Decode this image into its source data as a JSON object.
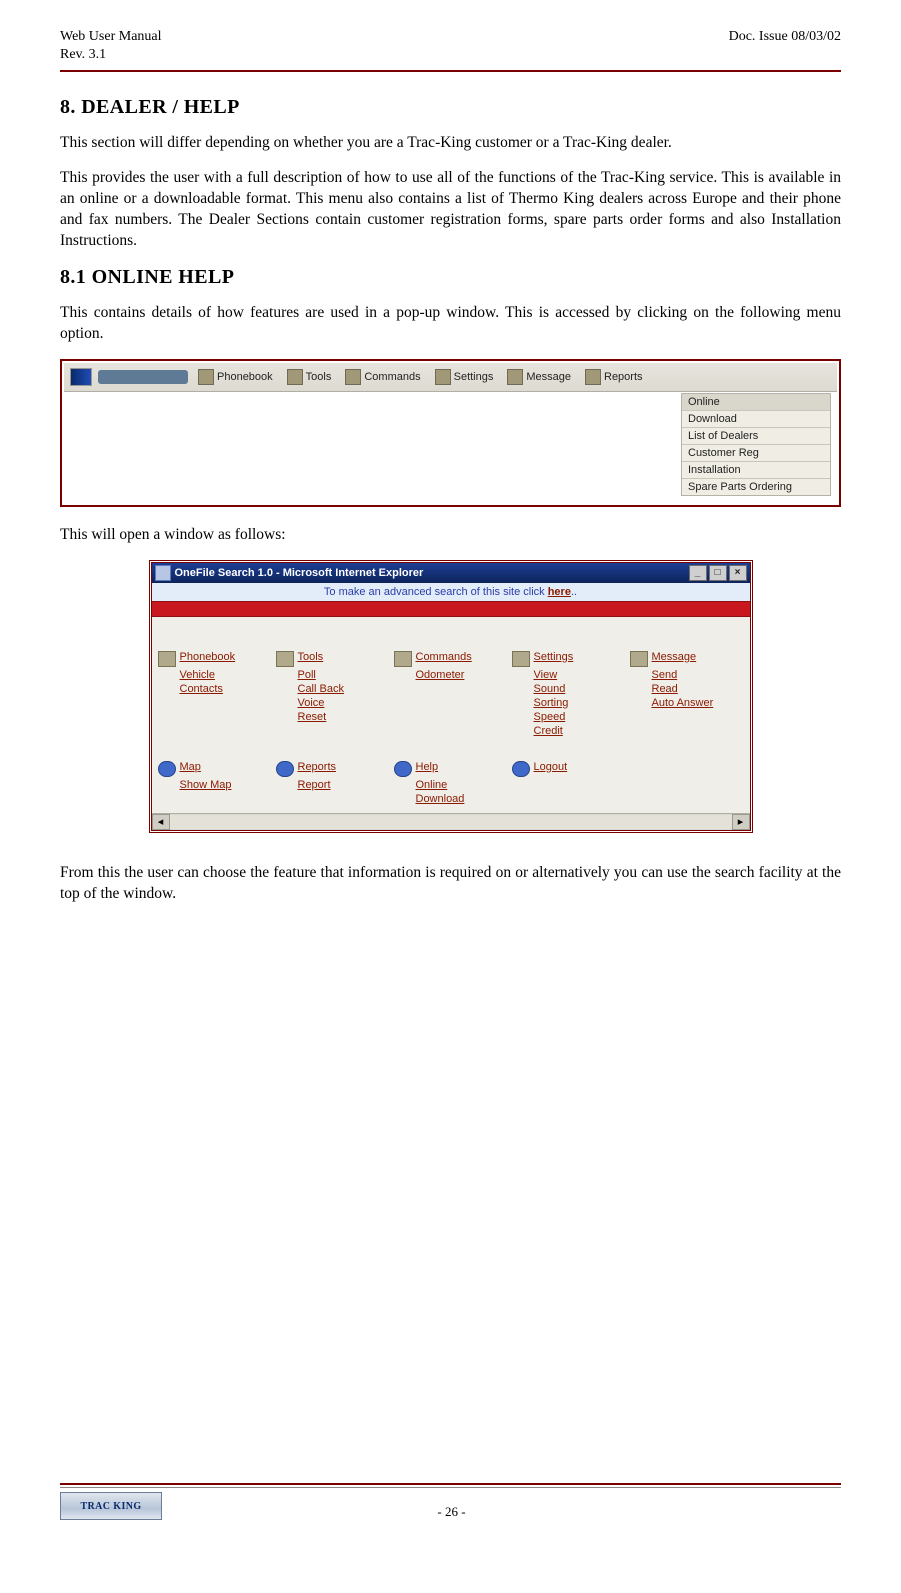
{
  "header": {
    "left1": "Web User Manual",
    "left2": "Rev. 3.1",
    "right": "Doc. Issue 08/03/02"
  },
  "section": {
    "h1": "8. DEALER / HELP",
    "p1": "This section will differ depending on whether you are a Trac-King customer or a Trac-King dealer.",
    "p2": "This provides the user with a full description of how to use all of the functions of the Trac-King service. This is available in an online or a downloadable format.  This menu also contains a list of Thermo King dealers across Europe and their phone and fax numbers.  The Dealer Sections contain customer registration forms, spare parts order forms and also Installation Instructions.",
    "h2": "8.1 ONLINE HELP",
    "p3": "This contains details of how features are used in a pop-up window.  This is accessed by clicking on the following menu option.",
    "p4": "This will open a window as follows:",
    "p5": "From this the user can choose the feature that information is required on or alternatively you can use the search facility at the top of the window."
  },
  "toolbar": {
    "items": [
      "Phonebook",
      "Tools",
      "Commands",
      "Settings",
      "Message",
      "Reports"
    ]
  },
  "dropdown": {
    "items": [
      "Online",
      "Download",
      "List of Dealers",
      "Customer Reg",
      "Installation",
      "Spare Parts Ordering"
    ]
  },
  "popup": {
    "title": "OneFile Search 1.0 - Microsoft Internet Explorer",
    "banner_pre": "To make an advanced search of this site click ",
    "banner_link": "here",
    "banner_post": "..",
    "cols": {
      "phonebook": {
        "head": "Phonebook",
        "items": [
          "Vehicle",
          "Contacts"
        ]
      },
      "tools": {
        "head": "Tools",
        "items": [
          "Poll",
          "Call Back",
          "Voice",
          "Reset"
        ]
      },
      "commands": {
        "head": "Commands",
        "items": [
          "Odometer"
        ]
      },
      "settings": {
        "head": "Settings",
        "items": [
          "View",
          "Sound",
          "Sorting",
          "Speed",
          "Credit"
        ]
      },
      "message": {
        "head": "Message",
        "items": [
          "Send",
          "Read",
          "Auto Answer"
        ]
      }
    },
    "row2": {
      "map": {
        "head": "Map",
        "items": [
          "Show Map"
        ]
      },
      "reports": {
        "head": "Reports",
        "items": [
          "Report"
        ]
      },
      "help": {
        "head": "Help",
        "items": [
          "Online",
          "Download"
        ]
      },
      "logout": {
        "head": "Logout",
        "items": []
      }
    }
  },
  "footer": {
    "logo": "TRAC  KING",
    "page": "- 26 -"
  }
}
